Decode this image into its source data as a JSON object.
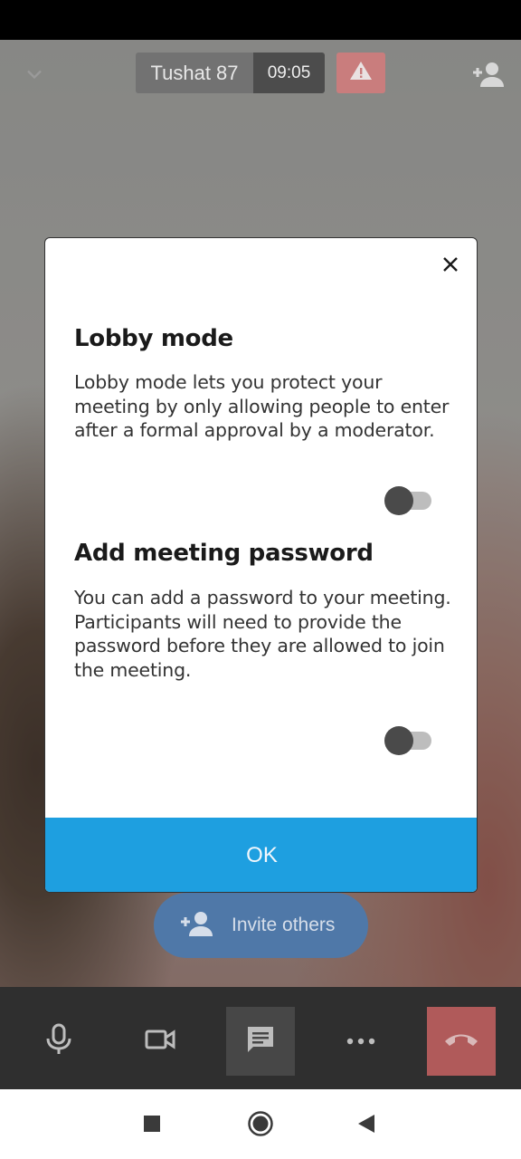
{
  "header": {
    "participant_name": "Tushat 87",
    "call_time": "09:05",
    "icons": {
      "collapse": "chevron-down-icon",
      "warning": "warning-icon",
      "add_participant": "add-person-icon"
    }
  },
  "invite": {
    "label": "Invite others",
    "icon": "add-person-icon"
  },
  "dialog": {
    "close_icon": "close-icon",
    "lobby": {
      "title": "Lobby mode",
      "description": "Lobby mode lets you protect your meeting by only allowing people to enter after a formal approval by a moderator.",
      "enabled": false
    },
    "password": {
      "title": "Add meeting password",
      "description": "You can add a password to your meeting. Participants will need to provide the password before they are allowed to join the meeting.",
      "enabled": false
    },
    "ok_label": "OK"
  },
  "toolbar": {
    "items": [
      "microphone-icon",
      "camera-icon",
      "chat-icon",
      "more-icon",
      "hangup-icon"
    ]
  },
  "navigation": {
    "items": [
      "recent-apps-icon",
      "home-icon",
      "back-icon"
    ]
  },
  "colors": {
    "accent": "#1e9fe0",
    "hangup": "#b05a5a",
    "warning": "#c97d7d"
  }
}
